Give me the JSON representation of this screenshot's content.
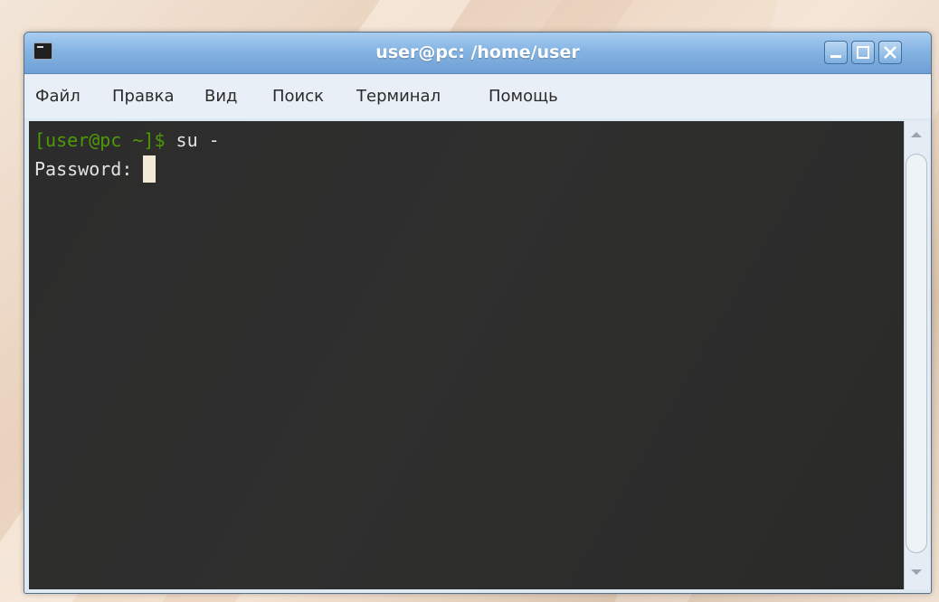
{
  "window": {
    "title": "user@pc: /home/user",
    "buttons": {
      "minimize": "minimize",
      "maximize": "maximize",
      "close": "close"
    }
  },
  "menu": {
    "items": [
      "Файл",
      "Правка",
      "Вид",
      "Поиск",
      "Терминал",
      "Помощь"
    ]
  },
  "terminal": {
    "prompt": "[user@pc ~]$",
    "command": " su -",
    "line2": "Password: ",
    "prompt_color": "#4e9a06",
    "background_color": "#2c2c2c",
    "text_color": "#e3e3e3"
  },
  "icons": {
    "app": "terminal-icon",
    "scroll_up": "scroll-up-arrow-icon",
    "scroll_down": "scroll-down-arrow-icon"
  }
}
